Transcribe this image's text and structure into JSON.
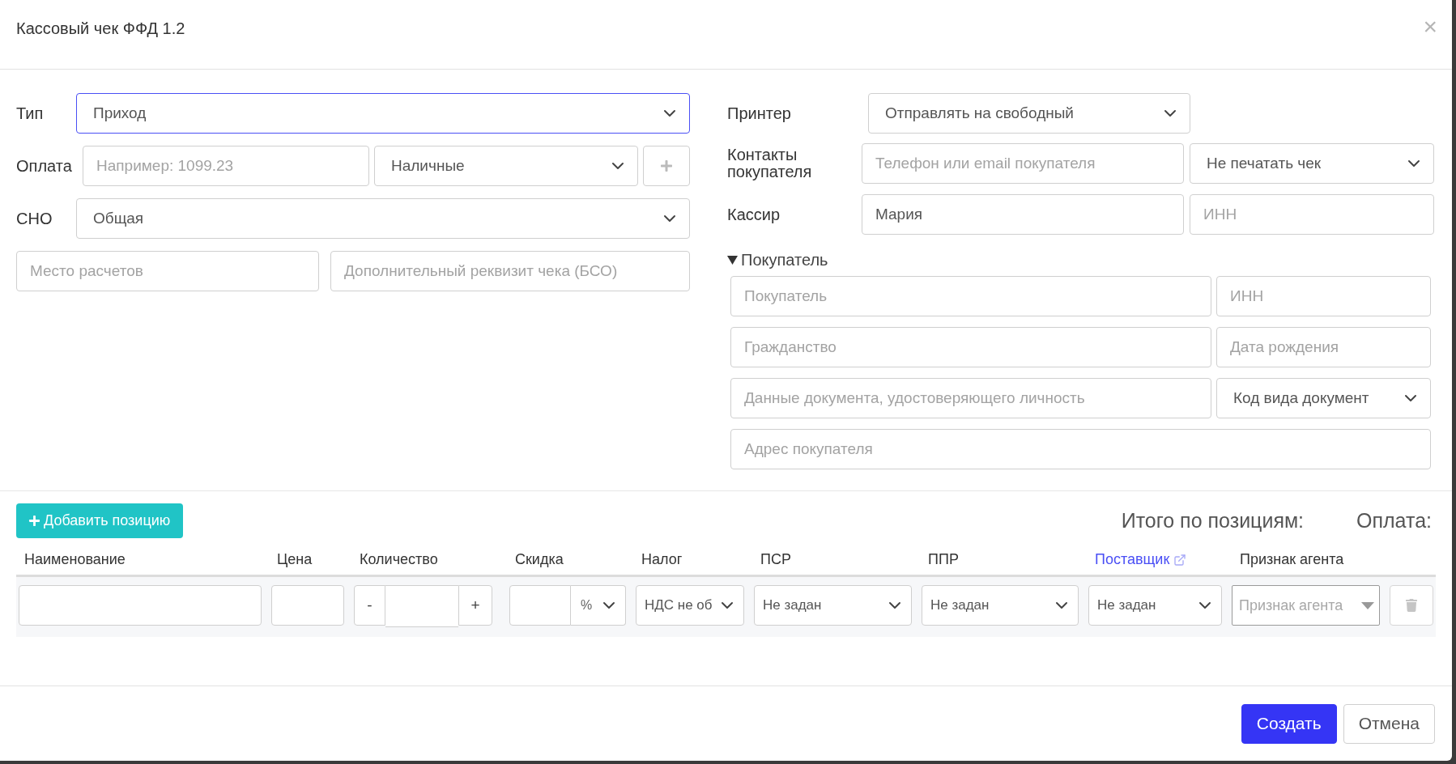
{
  "dialog": {
    "title": "Кассовый чек ФФД 1.2",
    "close": "×"
  },
  "type_field": {
    "label": "Тип",
    "value": "Приход",
    "focused": true
  },
  "payment": {
    "label": "Оплата",
    "amount_placeholder": "Например: 1099.23",
    "method": "Наличные"
  },
  "tax_system": {
    "label": "СНО",
    "value": "Общая"
  },
  "settlement_place": {
    "placeholder": "Место расчетов"
  },
  "extra_requisite": {
    "placeholder": "Дополнительный реквизит чека (БСО)"
  },
  "printer": {
    "label": "Принтер",
    "value": "Отправлять на свободный"
  },
  "contacts": {
    "label": "Контакты покупателя",
    "placeholder": "Телефон или email покупателя",
    "print_mode": "Не печатать чек"
  },
  "cashier": {
    "label": "Кассир",
    "value": "Мария",
    "inn_placeholder": "ИНН"
  },
  "buyer": {
    "label": "Покупатель",
    "expanded": true,
    "fields": [
      {
        "kind": "input",
        "placeholder": "Покупатель"
      },
      {
        "kind": "input",
        "placeholder": "ИНН"
      },
      {
        "kind": "input",
        "placeholder": "Гражданство"
      },
      {
        "kind": "input",
        "placeholder": "Дата рождения"
      },
      {
        "kind": "input",
        "placeholder": "Данные документа, удостоверяющего личность"
      },
      {
        "kind": "select",
        "value": "Код вида документ"
      },
      {
        "kind": "input",
        "placeholder": "Адрес покупателя"
      }
    ]
  },
  "add_button": "Добавить позицию",
  "totals": {
    "items_label": "Итого по позициям:",
    "payment_label": "Оплата:"
  },
  "table": {
    "columns": [
      {
        "label": "Наименование",
        "link": false
      },
      {
        "label": "Цена",
        "link": false
      },
      {
        "label": "Количество",
        "link": false
      },
      {
        "label": "Скидка",
        "link": false
      },
      {
        "label": "Налог",
        "link": false
      },
      {
        "label": "ПСР",
        "link": false
      },
      {
        "label": "ППР",
        "link": false
      },
      {
        "label": "Поставщик",
        "link": true
      },
      {
        "label": "Признак агента",
        "link": false
      }
    ],
    "rows": [
      {
        "cells": [
          {
            "kind": "input"
          },
          {
            "kind": "input"
          },
          {
            "kind": "stepper",
            "minus": "-",
            "plus": "+"
          },
          {
            "kind": "discount",
            "unit": "%"
          },
          {
            "kind": "select",
            "value": "НДС не об"
          },
          {
            "kind": "select",
            "value": "Не задан"
          },
          {
            "kind": "select",
            "value": "Не задан"
          },
          {
            "kind": "select",
            "value": "Не задан"
          },
          {
            "kind": "placeholder_select",
            "placeholder": "Признак агента"
          },
          {
            "kind": "delete"
          }
        ]
      }
    ]
  },
  "buttons": [
    {
      "label": "Создать",
      "primary": true
    },
    {
      "label": "Отмена",
      "primary": false
    }
  ]
}
